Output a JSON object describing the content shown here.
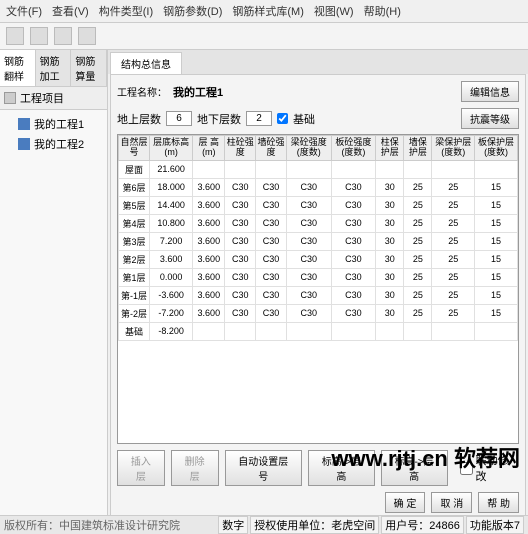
{
  "menu": [
    "文件(F)",
    "查看(V)",
    "构件类型(I)",
    "钢筋参数(D)",
    "钢筋样式库(M)",
    "视图(W)",
    "帮助(H)"
  ],
  "left_tabs": [
    "钢筋翻样",
    "钢筋加工",
    "钢筋算量"
  ],
  "tree_header": "工程项目",
  "tree": [
    "我的工程1",
    "我的工程2"
  ],
  "right_tab": "结构总信息",
  "project": {
    "label": "工程名称：",
    "value": "我的工程1",
    "edit_btn": "编辑信息"
  },
  "params": {
    "above_label": "地上层数",
    "above": "6",
    "below_label": "地下层数",
    "below": "2",
    "foundation_label": "基础",
    "seismic_btn": "抗震等级"
  },
  "headers": [
    "自然层号",
    "层底标高(m)",
    "层 高(m)",
    "柱砼强度",
    "墙砼强度",
    "梁砼强度(度数)",
    "板砼强度(度数)",
    "柱保护层",
    "墙保护层",
    "梁保护层(度数)",
    "板保护层(度数)"
  ],
  "rows": [
    [
      "屋面",
      "21.600",
      "",
      "",
      "",
      "",
      "",
      "",
      "",
      "",
      ""
    ],
    [
      "第6层",
      "18.000",
      "3.600",
      "C30",
      "C30",
      "C30",
      "C30",
      "30",
      "25",
      "25",
      "15"
    ],
    [
      "第5层",
      "14.400",
      "3.600",
      "C30",
      "C30",
      "C30",
      "C30",
      "30",
      "25",
      "25",
      "15"
    ],
    [
      "第4层",
      "10.800",
      "3.600",
      "C30",
      "C30",
      "C30",
      "C30",
      "30",
      "25",
      "25",
      "15"
    ],
    [
      "第3层",
      "7.200",
      "3.600",
      "C30",
      "C30",
      "C30",
      "C30",
      "30",
      "25",
      "25",
      "15"
    ],
    [
      "第2层",
      "3.600",
      "3.600",
      "C30",
      "C30",
      "C30",
      "C30",
      "30",
      "25",
      "25",
      "15"
    ],
    [
      "第1层",
      "0.000",
      "3.600",
      "C30",
      "C30",
      "C30",
      "C30",
      "30",
      "25",
      "25",
      "15"
    ],
    [
      "第-1层",
      "-3.600",
      "3.600",
      "C30",
      "C30",
      "C30",
      "C30",
      "30",
      "25",
      "25",
      "15"
    ],
    [
      "第-2层",
      "-7.200",
      "3.600",
      "C30",
      "C30",
      "C30",
      "C30",
      "30",
      "25",
      "25",
      "15"
    ],
    [
      "基础",
      "-8.200",
      "",
      "",
      "",
      "",
      "",
      "",
      "",
      "",
      ""
    ]
  ],
  "buttons": {
    "insert": "插入层",
    "delete": "删除层",
    "auto": "自动设置层号",
    "h2e": "标高->层高",
    "e2h": "标高->层高",
    "linked": "联动修改",
    "ok": "确 定",
    "cancel": "取 消",
    "help": "帮 助"
  },
  "watermark": "www.rjtj.cn 软荐网",
  "status": {
    "left": "版权所有：中国建筑标准设计研究院",
    "cells": [
      "数字",
      "授权使用单位：老虎空间",
      "用户号：24866",
      "功能版本7"
    ]
  }
}
